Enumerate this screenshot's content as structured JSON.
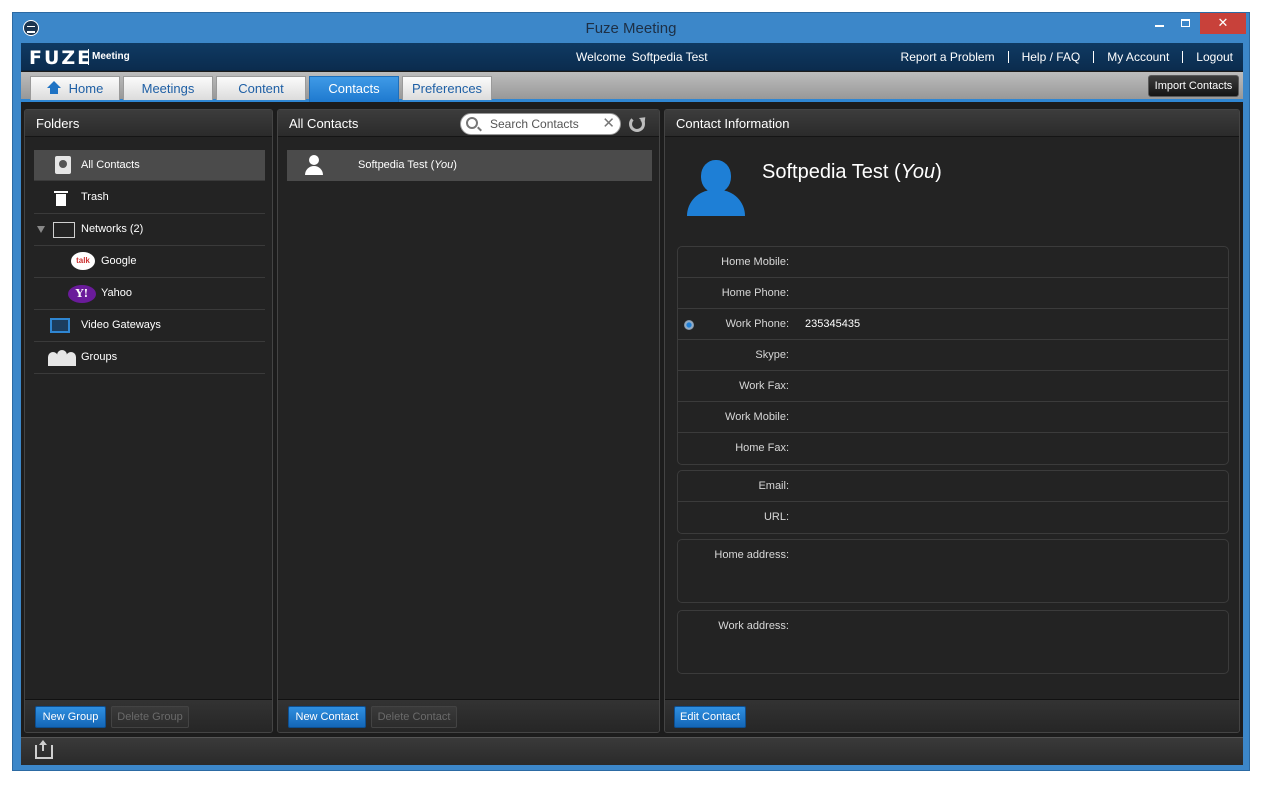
{
  "window": {
    "title": "Fuze Meeting"
  },
  "header": {
    "logo": "FUZE",
    "logo_sub": "Meeting",
    "welcome_prefix": "Welcome",
    "user_name": "Softpedia Test",
    "links": [
      "Report a Problem",
      "Help / FAQ",
      "My Account",
      "Logout"
    ]
  },
  "tabs": {
    "home": "Home",
    "meetings": "Meetings",
    "content": "Content",
    "contacts": "Contacts",
    "preferences": "Preferences",
    "active": "Contacts",
    "import_button": "Import Contacts"
  },
  "folders": {
    "title": "Folders",
    "items": [
      {
        "label": "All Contacts",
        "icon": "address-book-icon",
        "selected": true
      },
      {
        "label": "Trash",
        "icon": "trash-icon"
      },
      {
        "label": "Networks (2)",
        "icon": "network-icon"
      },
      {
        "label": "Google",
        "icon": "google-talk-icon"
      },
      {
        "label": "Yahoo",
        "icon": "yahoo-icon"
      },
      {
        "label": "Video Gateways",
        "icon": "video-gateway-icon"
      },
      {
        "label": "Groups",
        "icon": "groups-icon"
      }
    ],
    "new_group": "New Group",
    "delete_group": "Delete Group"
  },
  "contacts": {
    "title": "All Contacts",
    "search_placeholder": "Search Contacts",
    "list": [
      {
        "name": "Softpedia Test",
        "suffix": "You"
      }
    ],
    "new_contact": "New Contact",
    "delete_contact": "Delete Contact"
  },
  "info": {
    "title": "Contact Information",
    "name": "Softpedia Test",
    "name_suffix": "You",
    "phones": [
      {
        "label": "Home Mobile:",
        "value": ""
      },
      {
        "label": "Home Phone:",
        "value": ""
      },
      {
        "label": "Work Phone:",
        "value": "235345435",
        "primary": true
      },
      {
        "label": "Skype:",
        "value": ""
      },
      {
        "label": "Work Fax:",
        "value": ""
      },
      {
        "label": "Work Mobile:",
        "value": ""
      },
      {
        "label": "Home Fax:",
        "value": ""
      }
    ],
    "online": [
      {
        "label": "Email:",
        "value": ""
      },
      {
        "label": "URL:",
        "value": ""
      }
    ],
    "home_address_label": "Home address:",
    "work_address_label": "Work address:",
    "edit_contact": "Edit Contact"
  },
  "colors": {
    "accent": "#1e79cf",
    "window_frame": "#3c87c9",
    "close_button": "#c8413a",
    "panel_bg": "#232323"
  }
}
